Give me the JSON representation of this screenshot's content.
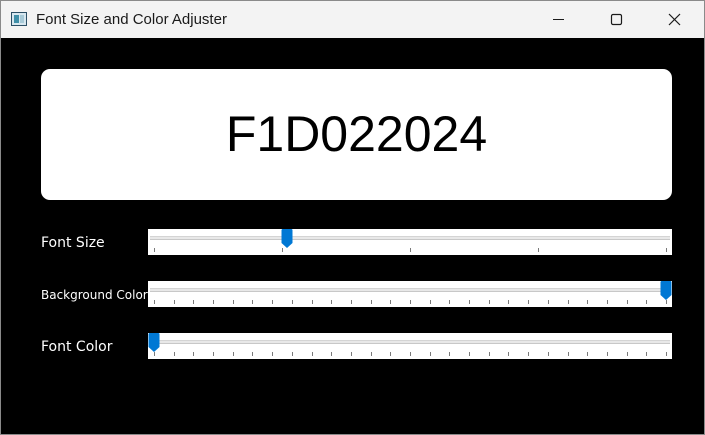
{
  "window": {
    "title": "Font Size and Color Adjuster"
  },
  "titlebar": {
    "icons": {
      "app": "app-window-icon",
      "minimize": "minimize-icon",
      "maximize": "maximize-icon",
      "close": "close-icon"
    }
  },
  "display": {
    "text": "F1D022024",
    "background_color": "#ffffff",
    "font_color": "#000000"
  },
  "controls": {
    "font_size": {
      "label": "Font Size",
      "value_fraction": 0.26,
      "tick_count": 5
    },
    "background_color": {
      "label": "Background Color",
      "value_fraction": 1.0,
      "tick_count": 27
    },
    "font_color": {
      "label": "Font Color",
      "value_fraction": 0.0,
      "tick_count": 27
    }
  },
  "colors": {
    "accent": "#0078d4",
    "window_background": "#000000",
    "titlebar": "#f3f3f3"
  }
}
